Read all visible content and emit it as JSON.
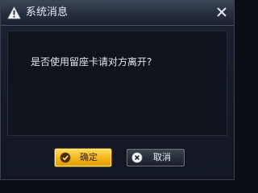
{
  "dialog": {
    "title": "系统消息",
    "title_icon": "warning-icon",
    "close_icon": "close-icon",
    "message": "是否使用留座卡请对方离开?"
  },
  "buttons": {
    "ok": {
      "label": "确定",
      "icon": "check-circle-icon"
    },
    "cancel": {
      "label": "取消",
      "icon": "x-circle-icon"
    }
  },
  "colors": {
    "ok_button": "#f6b81d",
    "cancel_button": "#262c38",
    "background": "#151a26",
    "text": "#e3e7ee"
  }
}
